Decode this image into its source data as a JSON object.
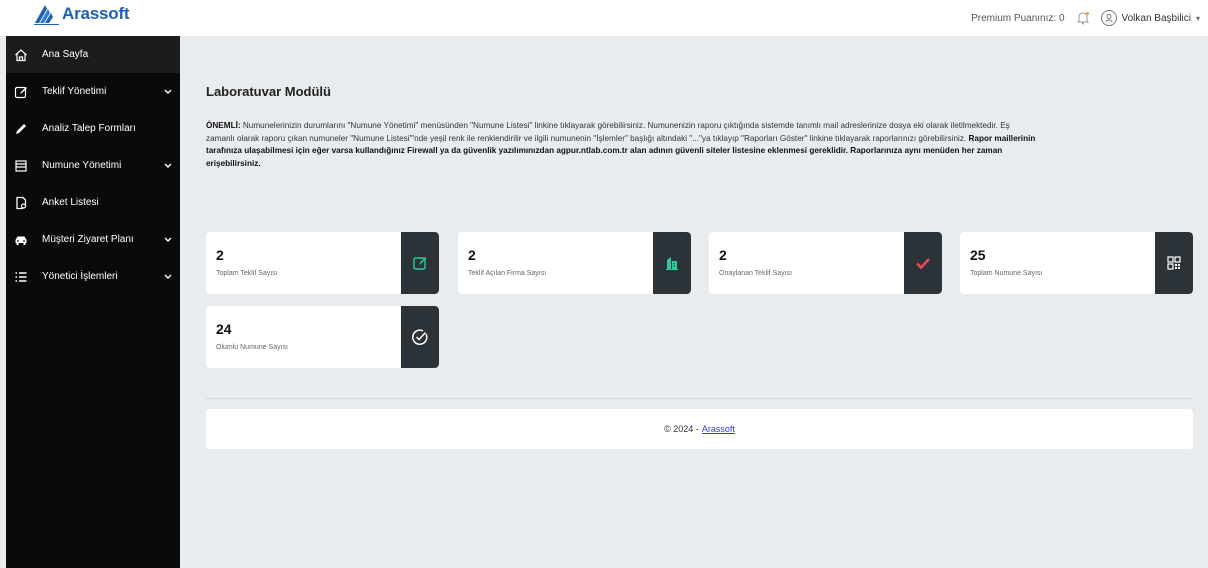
{
  "brand": {
    "name": "Arassoft",
    "color": "#1f5fb4"
  },
  "header": {
    "premium_text": "Premium Puanınız: 0",
    "user_name": "Volkan Başbilici"
  },
  "sidebar": {
    "items": [
      {
        "label": "Ana Sayfa",
        "icon": "home-icon",
        "has_submenu": false
      },
      {
        "label": "Teklif Yönetimi",
        "icon": "edit-icon",
        "has_submenu": true
      },
      {
        "label": "Analiz Talep Formları",
        "icon": "pen-icon",
        "has_submenu": false
      },
      {
        "label": "Numune Yönetimi",
        "icon": "box-icon",
        "has_submenu": true
      },
      {
        "label": "Anket Listesi",
        "icon": "survey-icon",
        "has_submenu": false
      },
      {
        "label": "Müşteri Ziyaret Planı",
        "icon": "car-icon",
        "has_submenu": true
      },
      {
        "label": "Yönetici İşlemleri",
        "icon": "list-icon",
        "has_submenu": true
      }
    ]
  },
  "main": {
    "title": "Laboratuvar Modülü",
    "notice": {
      "prefix": "ÖNEMLİ:",
      "text": " Numunelerinizin durumlarını \"Numune Yönetimi\" menüsünden \"Numune Listesi\" linkine tıklayarak görebilirsiniz. Numunenizin raporu çıktığında sistemde tanımlı mail adreslerinize dosya eki olarak iletilmektedir. Eş zamanlı olarak raporu çıkan numuneler \"Numune Listesi\"'nde yeşil renk ile renklendirilir ve ilgili numunenin \"İşlemler\" başlığı altındaki \"...\"ya tıklayıp \"Raporları Göster\" linkine tıklayarak raporlarınızı görebilirsiniz. ",
      "bold": "Rapor maillerinin tarafınıza ulaşabilmesi için eğer varsa kullandığınız Firewall ya da güvenlik yazılımınızdan agpur.ntlab.com.tr alan adının güvenli siteler listesine eklenmesi gereklidir. Raporlarınıza aynı menüden her zaman erişebilirsiniz."
    },
    "cards": [
      {
        "value": "2",
        "label": "Toplam Teklif Sayısı",
        "icon": "edit-icon",
        "icon_color": "#2ecc9a"
      },
      {
        "value": "2",
        "label": "Teklif Açılan Firma Sayısı",
        "icon": "building-icon",
        "icon_color": "#2ecc9a"
      },
      {
        "value": "2",
        "label": "Onaylanan Teklif Sayısı",
        "icon": "check-icon",
        "icon_color": "#e84a55"
      },
      {
        "value": "25",
        "label": "Toplam Numune Sayısı",
        "icon": "qr-icon",
        "icon_color": "#ffffff"
      },
      {
        "value": "24",
        "label": "Olumlu Numune Sayısı",
        "icon": "check-circle-icon",
        "icon_color": "#ffffff"
      }
    ]
  },
  "footer": {
    "copyright": "© 2024 -",
    "link": "Arassoft"
  }
}
